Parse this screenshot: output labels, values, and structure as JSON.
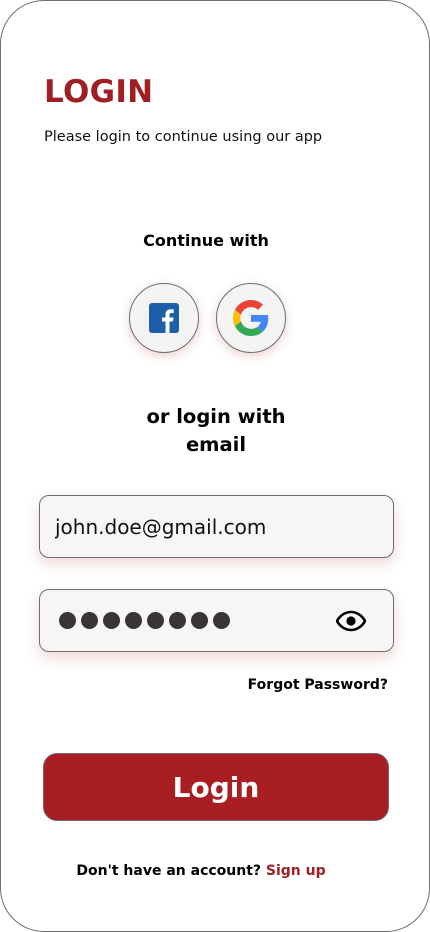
{
  "header": {
    "title": "LOGIN",
    "subtitle": "Please login to continue using our app"
  },
  "social": {
    "heading": "Continue with",
    "providers": [
      {
        "name": "facebook",
        "icon": "facebook-icon",
        "color": "#1b5fa8"
      },
      {
        "name": "google",
        "icon": "google-icon"
      }
    ]
  },
  "divider_text": "or login with email",
  "form": {
    "email_value": "john.doe@gmail.com",
    "password_mask_count": 8,
    "password_visibility_icon": "eye-icon",
    "forgot_label": "Forgot Password?",
    "submit_label": "Login"
  },
  "footer": {
    "prompt": "Don't have an account?",
    "signup_label": "Sign up"
  },
  "colors": {
    "accent": "#a01f24",
    "button": "#a81e22"
  }
}
